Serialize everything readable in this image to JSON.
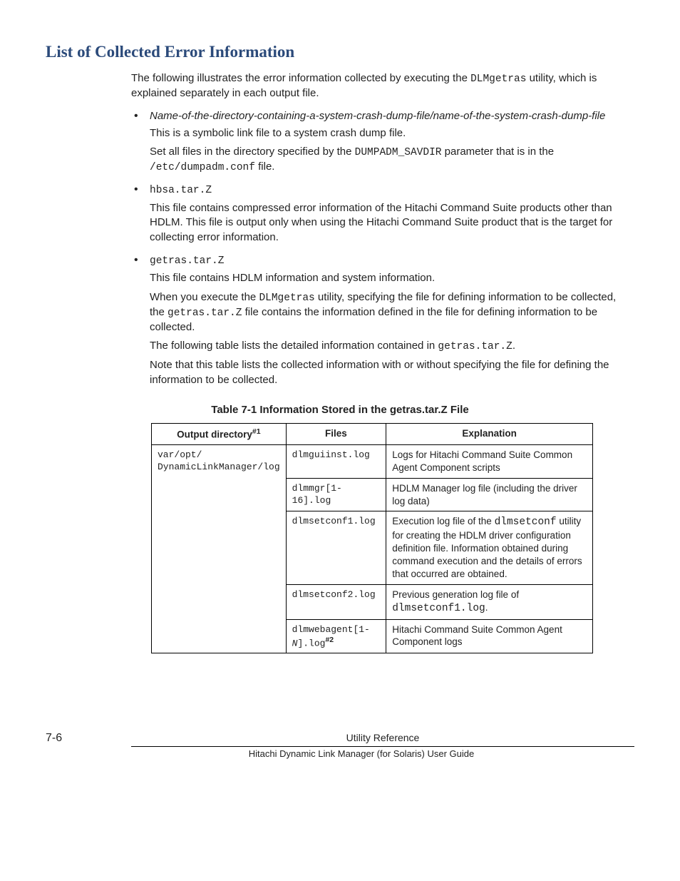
{
  "heading": "List of Collected Error Information",
  "intro": {
    "p1a": "The following illustrates the error information collected by executing the ",
    "p1code": "DLMgetras",
    "p1b": " utility, which is explained separately in each output file."
  },
  "bullets": {
    "b1": {
      "title_italic": "Name-of-the-directory-containing-a-system-crash-dump-file/name-of-the-system-crash-dump-file",
      "p1": "This is a symbolic link file to a system crash dump file.",
      "p2a": "Set all files in the directory specified by the ",
      "p2code": "DUMPADM_SAVDIR",
      "p2b": " parameter that is in the ",
      "p2code2": "/etc/dumpadm.conf",
      "p2c": " file."
    },
    "b2": {
      "title_code": "hbsa.tar.Z",
      "p1": "This file contains compressed error information of the Hitachi Command Suite products other than HDLM. This file is output only when using the Hitachi Command Suite product that is the target for collecting error information."
    },
    "b3": {
      "title_code": "getras.tar.Z",
      "p1": "This file contains HDLM information and system information.",
      "p2a": "When you execute the ",
      "p2code": "DLMgetras",
      "p2b": " utility, specifying the file for defining information to be collected, the ",
      "p2code2": "getras.tar.Z",
      "p2c": " file contains the information defined in the file for defining information to be collected.",
      "p3a": "The following table lists the detailed information contained in ",
      "p3code": "getras.tar.Z",
      "p3b": ".",
      "p4": "Note that this table lists the collected information with or without specifying the file for defining the information to be collected."
    }
  },
  "table": {
    "caption": "Table 7-1 Information Stored in the getras.tar.Z File",
    "headers": {
      "c1a": "Output directory",
      "c1sup": "#1",
      "c2": "Files",
      "c3": "Explanation"
    },
    "rows": [
      {
        "dir": "var/opt/\nDynamicLinkManager/log",
        "file": "dlmguiinst.log",
        "expl": "Logs for Hitachi Command Suite Common Agent Component scripts"
      },
      {
        "file": "dlmmgr[1-16].log",
        "expl": "HDLM Manager log file (including the driver log data)"
      },
      {
        "file": "dlmsetconf1.log",
        "expl_pre": "Execution log file of the ",
        "expl_code": "dlmsetconf",
        "expl_post": " utility for creating the HDLM driver configuration definition file. Information obtained during command execution and the details of errors that occurred are obtained."
      },
      {
        "file": "dlmsetconf2.log",
        "expl_pre": "Previous generation log file of ",
        "expl_code": "dlmsetconf1.log",
        "expl_post": "."
      },
      {
        "file_pre": "dlmwebagent[1-",
        "file_i": "N",
        "file_post": "].log",
        "file_sup": "#2",
        "expl": "Hitachi Command Suite Common Agent Component logs"
      }
    ]
  },
  "footer": {
    "page": "7-6",
    "title": "Utility Reference",
    "sub": "Hitachi Dynamic Link Manager (for Solaris) User Guide"
  }
}
